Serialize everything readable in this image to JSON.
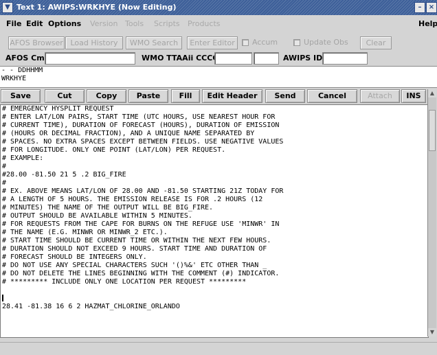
{
  "window": {
    "title": "Text 1: AWIPS:WRKHYE (Now Editing)"
  },
  "menus": [
    {
      "label": "File",
      "enabled": true
    },
    {
      "label": "Edit",
      "enabled": true
    },
    {
      "label": "Options",
      "enabled": true
    },
    {
      "label": "Version",
      "enabled": false
    },
    {
      "label": "Tools",
      "enabled": false
    },
    {
      "label": "Scripts",
      "enabled": false
    },
    {
      "label": "Products",
      "enabled": false
    }
  ],
  "help_label": "Help",
  "toolbar": {
    "afos_browser": "AFOS Browser",
    "load_history": "Load History",
    "wmo_search": "WMO Search",
    "enter_editor": "Enter Editor",
    "accum": "Accum",
    "update_obs": "Update Obs",
    "clear": "Clear"
  },
  "fields": {
    "afos_cmd_label": "AFOS Cmd:",
    "afos_cmd_value": "",
    "wmo_label": "WMO TTAAii CCCC:",
    "wmo_ttaaii": "",
    "wmo_cccc": "",
    "awips_label": "AWIPS ID:",
    "awips_id": ""
  },
  "header_text": [
    "- - DDHHMM",
    "WRKHYE"
  ],
  "edit_buttons": {
    "save": "Save",
    "cut": "Cut",
    "copy": "Copy",
    "paste": "Paste",
    "fill": "Fill",
    "edit_header": "Edit Header",
    "send": "Send",
    "cancel": "Cancel",
    "attach": "Attach",
    "ins": "INS"
  },
  "body_lines": [
    "# EMERGENCY HYSPLIT REQUEST",
    "# ENTER LAT/LON PAIRS, START TIME (UTC HOURS, USE NEAREST HOUR FOR",
    "# CURRENT TIME), DURATION OF FORECAST (HOURS), DURATION OF EMISSION",
    "# (HOURS OR DECIMAL FRACTION), AND A UNIQUE NAME SEPARATED BY",
    "# SPACES. NO EXTRA SPACES EXCEPT BETWEEN FIELDS. USE NEGATIVE VALUES",
    "# FOR LONGITUDE. ONLY ONE POINT (LAT/LON) PER REQUEST.",
    "# EXAMPLE:",
    "#",
    "#28.00 -81.50 21 5 .2 BIG_FIRE",
    "#",
    "# EX. ABOVE MEANS LAT/LON OF 28.00 AND -81.50 STARTING 21Z TODAY FOR",
    "# A LENGTH OF 5 HOURS. THE EMISSION RELEASE IS FOR .2 HOURS (12",
    "# MINUTES) THE NAME OF THE OUTPUT WILL BE BIG_FIRE.",
    "# OUTPUT SHOULD BE AVAILABLE WITHIN 5 MINUTES.",
    "# FOR REQUESTS FROM THE CAPE FOR BURNS ON THE REFUGE USE 'MINWR' IN",
    "# THE NAME (E.G. MINWR OR MINWR_2 ETC.).",
    "# START TIME SHOULD BE CURRENT TIME OR WITHIN THE NEXT FEW HOURS.",
    "# DURATION SHOULD NOT EXCEED 9 HOURS. START TIME AND DURATION OF",
    "# FORECAST SHOULD BE INTEGERS ONLY.",
    "# DO NOT USE ANY SPECIAL CHARACTERS SUCH '()%&' ETC OTHER THAN _",
    "# DO NOT DELETE THE LINES BEGINNING WITH THE COMMENT (#) INDICATOR.",
    "# ********* INCLUDE ONLY ONE LOCATION PER REQUEST *********",
    "",
    "",
    "28.41 -81.38 16 6 2 HAZMAT_CHLORINE_ORLANDO"
  ],
  "colors": {
    "title_bar": "#3d5f99",
    "disabled_text": "#a4a4a4",
    "text_bg": "#ffffff"
  }
}
